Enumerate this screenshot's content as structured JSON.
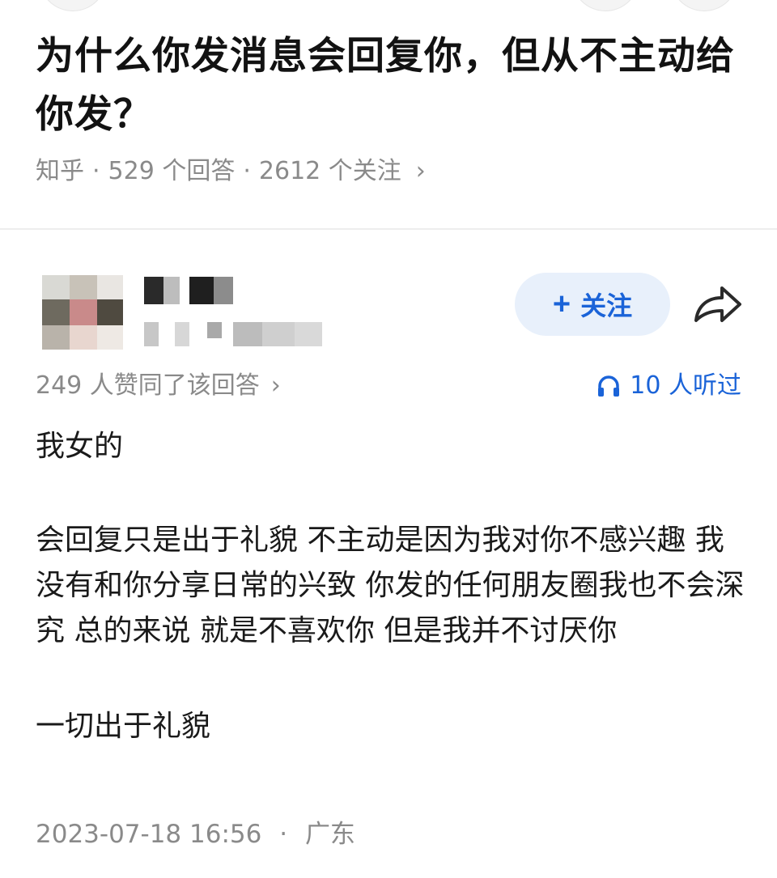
{
  "question": {
    "title": "为什么你发消息会回复你，但从不主动给你发？",
    "source": "知乎",
    "answer_count": "529 个回答",
    "follow_count": "2612 个关注",
    "separator": "·",
    "chevron": "›"
  },
  "author": {
    "follow_label": "关注",
    "follow_plus": "+"
  },
  "answer_meta": {
    "upvotes": "249 人赞同了该回答",
    "chevron": "›",
    "listen": "10 人听过"
  },
  "answer": {
    "paragraphs": [
      "我女的",
      "会回复只是出于礼貌 不主动是因为我对你不感兴趣 我没有和你分享日常的兴致 你发的任何朋友圈我也不会深究 总的来说 就是不喜欢你 但是我并不讨厌你",
      "一切出于礼貌"
    ]
  },
  "footer": {
    "datetime": "2023-07-18 16:56",
    "separator": "·",
    "location": "广东"
  },
  "colors": {
    "accent": "#1a63d8",
    "follow_bg": "#e8f0fb",
    "meta_gray": "#8a8a8a"
  },
  "icons": [
    "share-icon",
    "headphones-icon",
    "chevron-right-icon",
    "plus-icon"
  ]
}
